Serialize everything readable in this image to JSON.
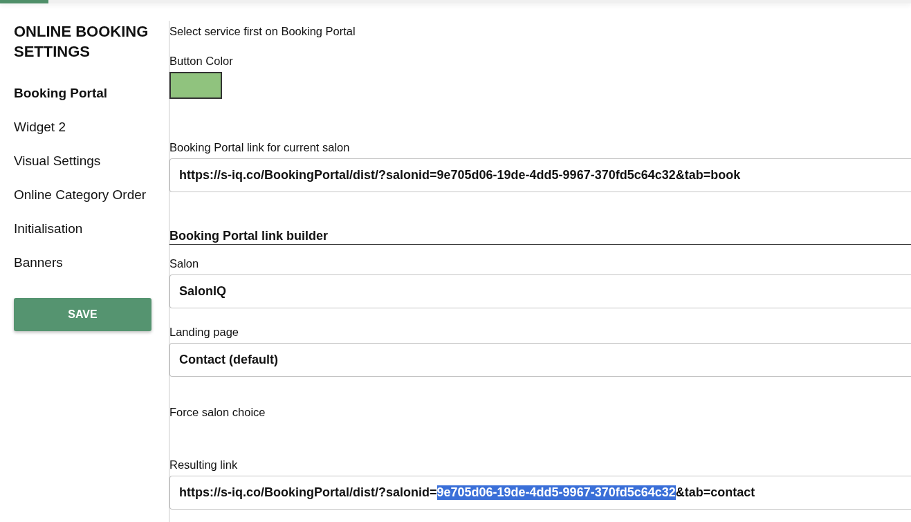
{
  "top_bar": {
    "tabs": [
      {
        "selected": true
      }
    ]
  },
  "sidebar": {
    "title": "ONLINE BOOKING SETTINGS",
    "items": [
      {
        "label": "Booking Portal",
        "selected": true
      },
      {
        "label": "Widget 2",
        "selected": false
      },
      {
        "label": "Visual Settings",
        "selected": false
      },
      {
        "label": "Online Category Order",
        "selected": false
      },
      {
        "label": "Initialisation",
        "selected": false
      },
      {
        "label": "Banners",
        "selected": false
      }
    ],
    "save_button": "SAVE"
  },
  "content": {
    "note": "Select service first on Booking Portal",
    "button_color": {
      "label": "Button Color",
      "color": "#90c37e"
    },
    "current_link": {
      "label": "Booking Portal link for current salon",
      "value": "https://s-iq.co/BookingPortal/dist/?salonid=9e705d06-19de-4dd5-9967-370fd5c64c32&tab=book"
    },
    "builder_heading": "Booking Portal link builder",
    "salon": {
      "label": "Salon",
      "value": "SalonIQ"
    },
    "landing_page": {
      "label": "Landing page",
      "value": "Contact (default)"
    },
    "force_salon_choice": {
      "label": "Force salon choice"
    },
    "resulting_link": {
      "label": "Resulting link",
      "parts": [
        {
          "text": "https://s-iq.co/BookingPortal/dist/?salonid=",
          "selected": false
        },
        {
          "text": "9e705d06-19de-4dd5-9967-370fd5c64c32",
          "selected": true
        },
        {
          "text": "&tab=contact",
          "selected": false
        }
      ]
    }
  }
}
